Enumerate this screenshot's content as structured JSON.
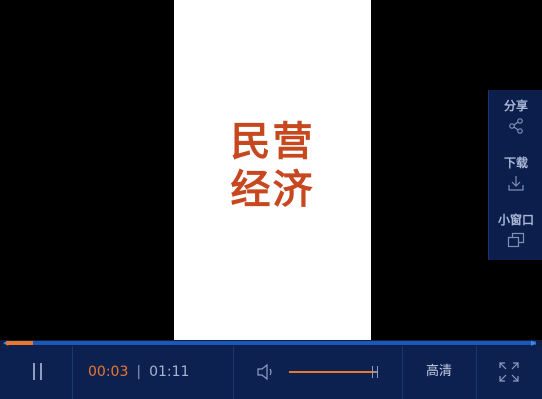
{
  "video": {
    "logo_line1": "民营",
    "logo_line2": "经济",
    "logo_color": "#c7471f"
  },
  "side_panel": {
    "items": [
      {
        "label": "分享",
        "icon": "share-icon"
      },
      {
        "label": "下载",
        "icon": "download-icon"
      },
      {
        "label": "小窗口",
        "icon": "mini-window-icon"
      }
    ],
    "label_color": "#a9b6d6"
  },
  "player": {
    "current_time": "00:03",
    "separator": "|",
    "total_time": "01:11",
    "progress_fraction": 0.05,
    "buffer_fraction": 1.0,
    "volume_fraction": 0.98,
    "quality_label": "高清",
    "accent_color": "#e9782d"
  }
}
